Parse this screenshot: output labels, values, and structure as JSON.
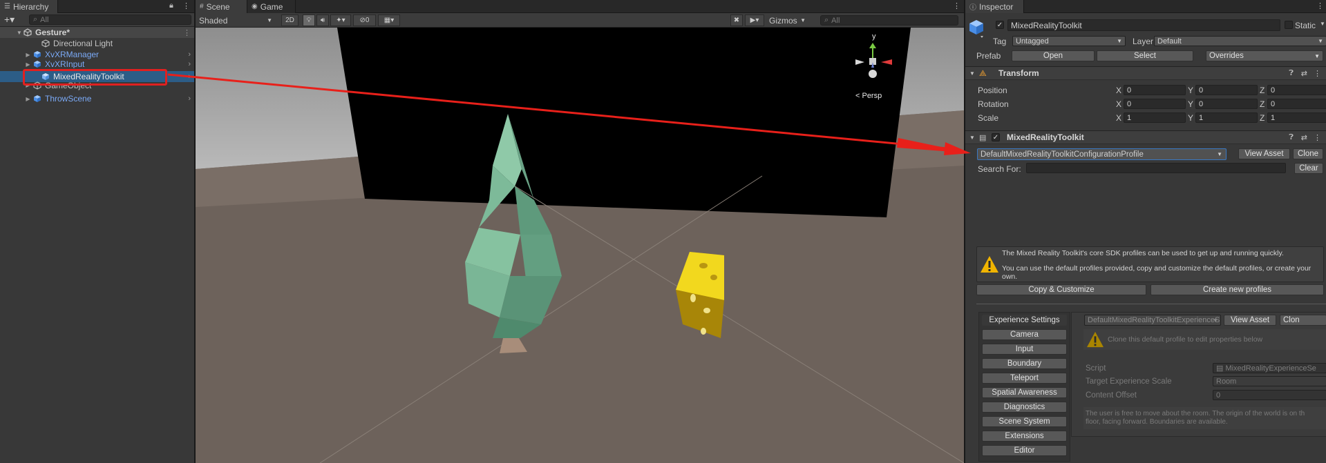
{
  "hierarchy": {
    "tab_title": "Hierarchy",
    "add_label": "+▾",
    "search_placeholder": "All",
    "scene_name": "Gesture*",
    "items": [
      {
        "label": "Directional Light"
      },
      {
        "label": "XvXRManager"
      },
      {
        "label": "XvXRInput"
      },
      {
        "label": "MixedRealityToolkit"
      },
      {
        "label": "GameObject"
      },
      {
        "label": "ThrowScene"
      }
    ]
  },
  "scene": {
    "tabs": [
      "Scene",
      "Game"
    ],
    "shading_mode": "Shaded",
    "mode_2d": "2D",
    "hidden_count": "0",
    "gizmos_label": "Gizmos",
    "search_placeholder": "All",
    "persp_label": "< Persp",
    "gizmo_axis_label": "y"
  },
  "inspector": {
    "tab_title": "Inspector",
    "object_name": "MixedRealityToolkit",
    "static_label": "Static",
    "tag_label": "Tag",
    "tag_value": "Untagged",
    "layer_label": "Layer",
    "layer_value": "Default",
    "prefab_label": "Prefab",
    "open_label": "Open",
    "select_label": "Select",
    "overrides_label": "Overrides",
    "transform": {
      "title": "Transform",
      "rows": [
        {
          "label": "Position",
          "x": "0",
          "y": "0",
          "z": "0"
        },
        {
          "label": "Rotation",
          "x": "0",
          "y": "0",
          "z": "0"
        },
        {
          "label": "Scale",
          "x": "1",
          "y": "1",
          "z": "1"
        }
      ],
      "axis_x": "X",
      "axis_y": "Y",
      "axis_z": "Z"
    },
    "mrtk": {
      "title": "MixedRealityToolkit",
      "profile_value": "DefaultMixedRealityToolkitConfigurationProfile",
      "view_asset_label": "View Asset",
      "clone_label": "Clone",
      "search_for_label": "Search For:",
      "clear_label": "Clear",
      "info_line1": "The Mixed Reality Toolkit's core SDK profiles can be used to get up and running quickly.",
      "info_line2": "You can use the default profiles provided, copy and customize the default profiles, or create your own.",
      "copy_customize_label": "Copy & Customize",
      "create_profiles_label": "Create new profiles",
      "nav_items": [
        "Experience Settings",
        "Camera",
        "Input",
        "Boundary",
        "Teleport",
        "Spatial Awareness",
        "Diagnostics",
        "Scene System",
        "Extensions",
        "Editor"
      ],
      "exp_profile_value": "DefaultMixedRealityToolkitExperienceS",
      "exp_view_asset_label": "View Asset",
      "exp_clone_label": "Clon",
      "clone_hint": "Clone this default profile to edit properties below",
      "script_label": "Script",
      "script_value": "MixedRealityExperienceSe",
      "target_scale_label": "Target Experience Scale",
      "target_scale_value": "Room",
      "content_offset_label": "Content Offset",
      "content_offset_value": "0",
      "scale_desc_line1": "The user is free to move about the room. The origin of the world is on th",
      "scale_desc_line2": "floor, facing forward. Boundaries are available."
    }
  },
  "colors": {
    "highlight_box": "#e02020",
    "annotation_arrow": "#e8201a",
    "prefab_blue": "#7baaf7",
    "sky": "#9a9a9a",
    "ground": "#6d625b",
    "tree": "#7fb89a",
    "cheese": "#e0c21c"
  }
}
